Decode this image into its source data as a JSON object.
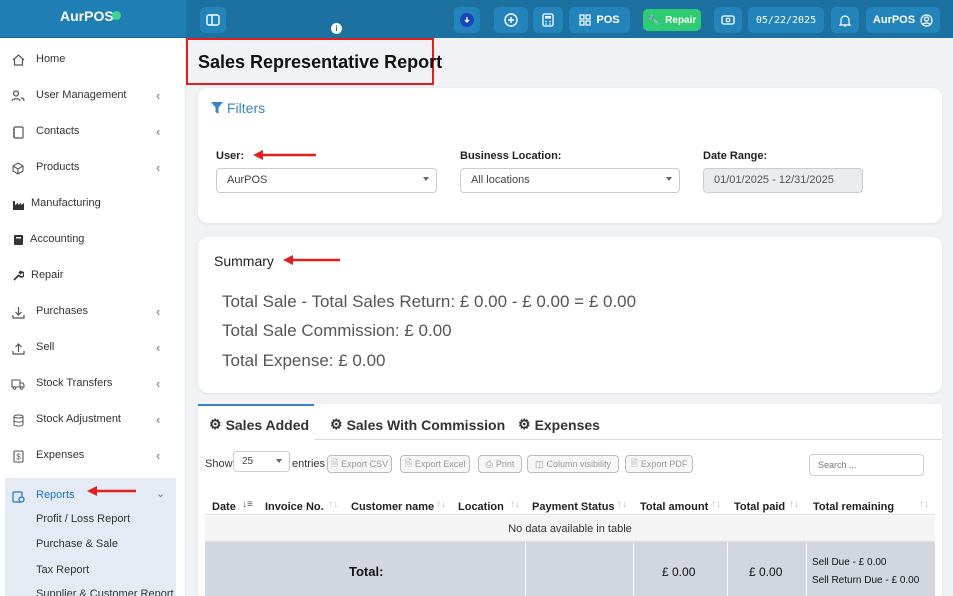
{
  "app": {
    "brand": "AurPOS",
    "colors": {
      "topbar": "#1c71a0",
      "accent": "#1f6fd8",
      "repair_button": "#2ecc71",
      "annotation": "#e02020",
      "status_dot": "#3dd68c"
    }
  },
  "topbar": {
    "pos_label": "POS",
    "repair_label": "Repair",
    "date": "05/22/2025",
    "user_label": "AurPOS",
    "icons": [
      "sidebar-toggle-icon",
      "info-icon",
      "download-icon",
      "plus-circle-icon",
      "calculator-icon",
      "grid-icon",
      "wrench-icon",
      "money-icon",
      "bell-icon",
      "user-circle-icon"
    ]
  },
  "sidebar": {
    "items": [
      {
        "label": "Home",
        "icon": "home-icon",
        "chevron": false
      },
      {
        "label": "User Management",
        "icon": "users-icon",
        "chevron": true
      },
      {
        "label": "Contacts",
        "icon": "address-book-icon",
        "chevron": true
      },
      {
        "label": "Products",
        "icon": "cube-icon",
        "chevron": true
      },
      {
        "label": "Manufacturing",
        "icon": "industry-icon",
        "chevron": false
      },
      {
        "label": "Accounting",
        "icon": "book-icon",
        "chevron": false
      },
      {
        "label": "Repair",
        "icon": "wrench-icon",
        "chevron": false
      },
      {
        "label": "Purchases",
        "icon": "download-icon",
        "chevron": true
      },
      {
        "label": "Sell",
        "icon": "upload-icon",
        "chevron": true
      },
      {
        "label": "Stock Transfers",
        "icon": "truck-icon",
        "chevron": true
      },
      {
        "label": "Stock Adjustment",
        "icon": "database-icon",
        "chevron": true
      },
      {
        "label": "Expenses",
        "icon": "receipt-icon",
        "chevron": true
      },
      {
        "label": "Reports",
        "icon": "report-icon",
        "chevron": true,
        "active": true
      }
    ],
    "subitems": [
      "Profit / Loss Report",
      "Purchase & Sale",
      "Tax Report",
      "Supplier & Customer Report"
    ]
  },
  "page": {
    "title": "Sales Representative Report"
  },
  "filters": {
    "title": "Filters",
    "user_label": "User:",
    "user_value": "AurPOS",
    "location_label": "Business Location:",
    "location_value": "All locations",
    "date_label": "Date Range:",
    "date_value": "01/01/2025 - 12/31/2025"
  },
  "summary": {
    "title": "Summary",
    "line1": "Total Sale - Total Sales Return: £ 0.00 - £ 0.00 = £ 0.00",
    "line2": "Total Sale Commission: £ 0.00",
    "line3": "Total Expense: £ 0.00"
  },
  "tabs": [
    {
      "label": "Sales Added",
      "active": true
    },
    {
      "label": "Sales With Commission",
      "active": false
    },
    {
      "label": "Expenses",
      "active": false
    }
  ],
  "table_controls": {
    "show_label": "Show",
    "entries_value": "25",
    "entries_label": "entries",
    "buttons": [
      "Export CSV",
      "Export Excel",
      "Print",
      "Column visibility",
      "Export PDF"
    ],
    "search_placeholder": "Search ..."
  },
  "table": {
    "columns": [
      "Date",
      "Invoice No.",
      "Customer name",
      "Location",
      "Payment Status",
      "Total amount",
      "Total paid",
      "Total remaining"
    ],
    "empty_message": "No data available in table",
    "footer": {
      "label": "Total:",
      "total_amount": "£ 0.00",
      "total_paid": "£ 0.00",
      "sell_due": "Sell Due - £ 0.00",
      "sell_return_due": "Sell Return Due - £ 0.00"
    }
  }
}
